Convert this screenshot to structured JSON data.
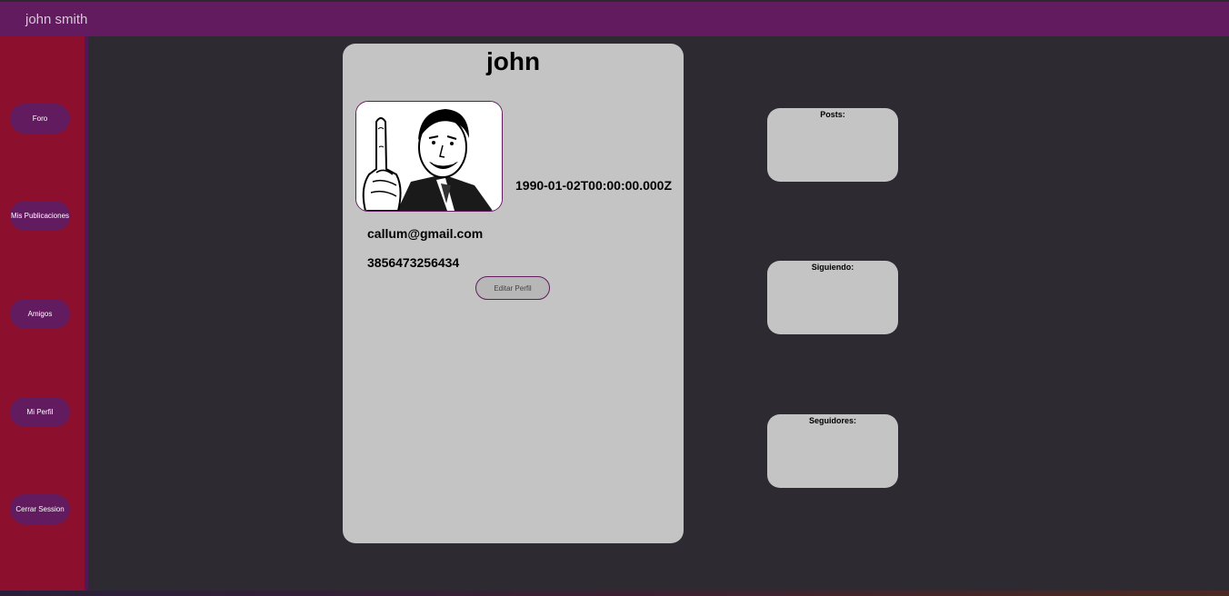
{
  "header": {
    "user_name": "john smith"
  },
  "sidebar": {
    "items": [
      {
        "label": "Foro"
      },
      {
        "label": "Mis Publicaciones"
      },
      {
        "label": "Amigos"
      },
      {
        "label": "Mi Perfil"
      },
      {
        "label": "Cerrar Session"
      }
    ]
  },
  "profile": {
    "name": "john",
    "birthdate": "1990-01-02T00:00:00.000Z",
    "email": "callum@gmail.com",
    "phone": "3856473256434",
    "edit_label": "Editar Perfil",
    "avatar_icon": "profile-photo"
  },
  "stats": {
    "posts_label": "Posts:",
    "following_label": "Siguiendo:",
    "followers_label": "Seguidores:"
  },
  "colors": {
    "header": "#611b5e",
    "sidebar": "#8c0f2e",
    "background": "#2d2b31",
    "card": "#c4c4c4"
  }
}
